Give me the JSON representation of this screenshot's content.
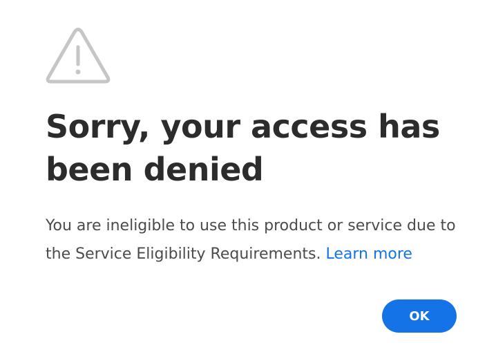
{
  "dialog": {
    "icon": "warning-triangle-icon",
    "title": "Sorry, your access has been denied",
    "message": "You are ineligible to use this product or service due to the Service Eligibility Requirements.",
    "learn_more_label": "Learn more",
    "ok_label": "OK"
  },
  "colors": {
    "accent": "#1473e6",
    "title_text": "#2c2c2c",
    "body_text": "#4b4b4b",
    "icon": "#c6c6c6"
  }
}
